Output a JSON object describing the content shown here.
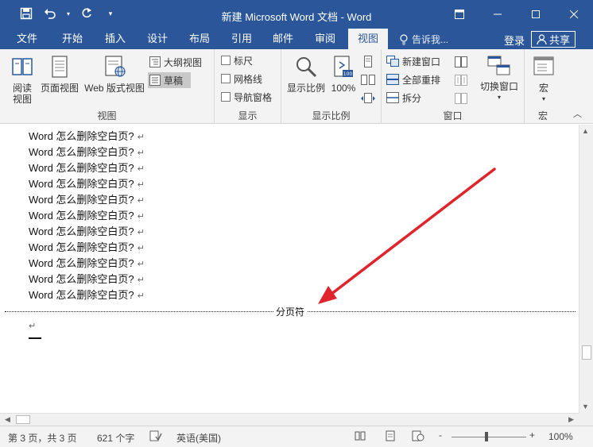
{
  "window": {
    "title": "新建 Microsoft Word 文档 - Word"
  },
  "tabs": [
    {
      "label": "文件"
    },
    {
      "label": "开始"
    },
    {
      "label": "插入"
    },
    {
      "label": "设计"
    },
    {
      "label": "布局"
    },
    {
      "label": "引用"
    },
    {
      "label": "邮件"
    },
    {
      "label": "审阅"
    },
    {
      "label": "视图",
      "active": true
    }
  ],
  "tell_me": "告诉我...",
  "login": "登录",
  "share": "共享",
  "ribbon": {
    "views": {
      "read_mode": [
        "阅读",
        "视图"
      ],
      "print_layout": "页面视图",
      "web_layout": "Web 版式视图",
      "outline": "大纲视图",
      "draft": "草稿",
      "label": "视图"
    },
    "show": {
      "ruler": "标尺",
      "gridlines": "网格线",
      "nav_pane": "导航窗格",
      "label": "显示"
    },
    "zoom": {
      "zoom_btn": "显示比例",
      "hundred": "100%",
      "label": "显示比例"
    },
    "window": {
      "new_window": "新建窗口",
      "arrange_all": "全部重排",
      "split": "拆分",
      "switch_windows": "切换窗口",
      "label": "窗口"
    },
    "macros": {
      "macros_btn": "宏",
      "label": "宏"
    }
  },
  "document": {
    "lines": [
      "Word 怎么删除空白页?",
      "Word 怎么删除空白页?",
      "Word 怎么删除空白页?",
      "Word 怎么删除空白页?",
      "Word 怎么删除空白页?",
      "Word 怎么删除空白页?",
      "Word 怎么删除空白页?",
      "Word 怎么删除空白页?",
      "Word 怎么删除空白页?",
      "Word 怎么删除空白页?",
      "Word 怎么删除空白页?"
    ],
    "para_mark": "↵",
    "page_break_label": "分页符"
  },
  "status": {
    "page": "第 3 页，共 3 页",
    "words": "621 个字",
    "language": "英语(美国)",
    "zoom_minus": "-",
    "zoom_plus": "+",
    "zoom_level": "100%",
    "zoom_fraction": 0.47
  },
  "colors": {
    "accent": "#2b579a",
    "arrow": "#e0242c"
  }
}
